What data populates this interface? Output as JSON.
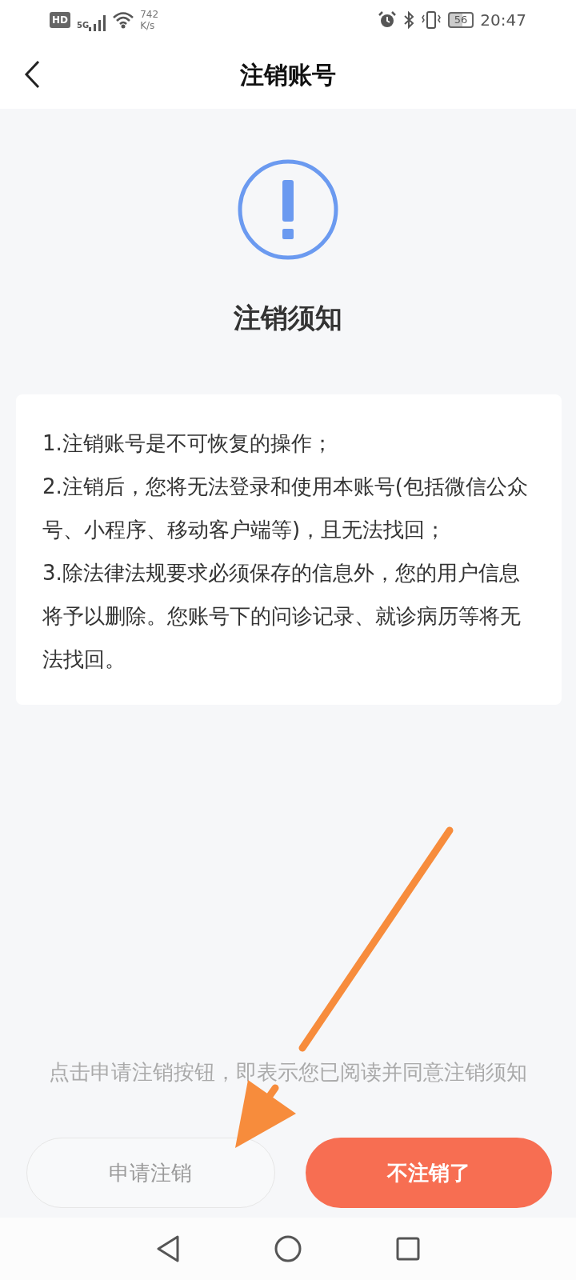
{
  "status_bar": {
    "hd_label": "HD",
    "network_label": "5G",
    "speed_value": "742",
    "speed_unit": "K/s",
    "battery": "56",
    "time": "20:47"
  },
  "header": {
    "title": "注销账号"
  },
  "notice": {
    "title": "注销须知",
    "items": [
      "1.注销账号是不可恢复的操作；",
      "2.注销后，您将无法登录和使用本账号(包括微信公众号、小程序、移动客户端等)，且无法找回；",
      "3.除法律法规要求必须保存的信息外，您的用户信息将予以删除。您账号下的问诊记录、就诊病历等将无法找回。"
    ]
  },
  "consent_text": "点击申请注销按钮，即表示您已阅读并同意注销须知",
  "buttons": [
    {
      "label": "申请注销",
      "kind": "secondary"
    },
    {
      "label": "不注销了",
      "kind": "primary"
    }
  ]
}
